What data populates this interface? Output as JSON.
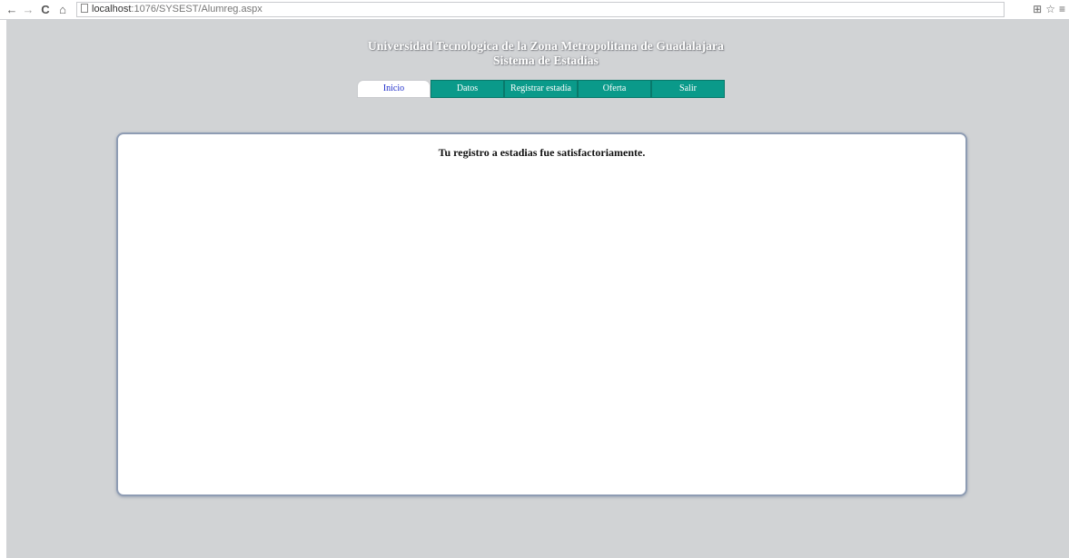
{
  "browser": {
    "back_glyph": "←",
    "forward_glyph": "→",
    "reload_glyph": "C",
    "home_glyph": "⌂",
    "url_host": "localhost",
    "url_path": ":1076/SYSEST/Alumreg.aspx",
    "translate_glyph": "⊞",
    "star_glyph": "☆",
    "menu_glyph": "≡",
    "icons": [
      "back-arrow-icon",
      "forward-arrow-icon",
      "reload-icon",
      "home-icon",
      "page-icon",
      "translate-icon",
      "star-icon",
      "menu-icon"
    ]
  },
  "header": {
    "title": "Universidad Tecnologica de la Zona Metropolitana de Guadalajara",
    "subtitle": "Sistema de Estadias"
  },
  "menu": {
    "items": [
      {
        "label": "Inicio",
        "active": true
      },
      {
        "label": "Datos",
        "active": false
      },
      {
        "label": "Registrar estadía",
        "active": false
      },
      {
        "label": "Oferta",
        "active": false
      },
      {
        "label": "Salir",
        "active": false
      }
    ]
  },
  "content": {
    "message": "Tu registro a estadias fue satisfactoriamente."
  },
  "colors": {
    "page_background": "#d1d3d5",
    "menu_teal": "#0a9a8a",
    "active_tab_text": "#1f2ecb",
    "panel_border": "#8e9cb3"
  }
}
